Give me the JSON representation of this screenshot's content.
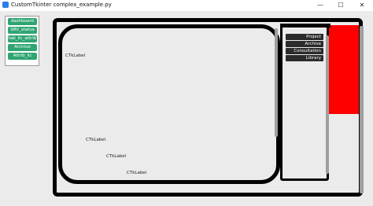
{
  "window": {
    "title": "CustomTkinter complex_example.py",
    "minimize_glyph": "—",
    "maximize_glyph": "☐",
    "close_glyph": "✕"
  },
  "sidebar": {
    "buttons": [
      {
        "label": "dashboard"
      },
      {
        "label": "SRV_status"
      },
      {
        "label": "tab_lic_attrib"
      },
      {
        "label": "Archive"
      },
      {
        "label": "Attrib_lic"
      }
    ]
  },
  "menu": {
    "items": [
      {
        "label": "Project"
      },
      {
        "label": "Archive"
      },
      {
        "label": "Consultation"
      },
      {
        "label": "Library"
      }
    ]
  },
  "labels": [
    {
      "text": "CTkLabel"
    },
    {
      "text": "CTkLabel"
    },
    {
      "text": "CTkLabel"
    },
    {
      "text": "CTkLabel"
    }
  ],
  "colors": {
    "accent_green": "#2fa572",
    "red_panel": "#ff0000",
    "frame_border": "#000000",
    "menu_bg": "#2b2b2b"
  },
  "icons": {
    "app": "customtkinter-app-icon"
  }
}
